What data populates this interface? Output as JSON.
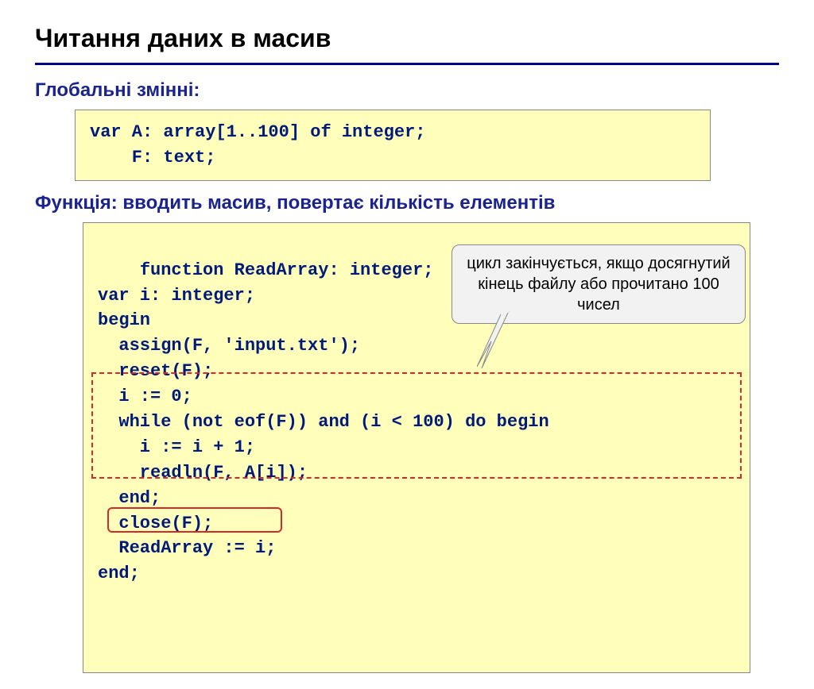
{
  "title": "Читання даних в масив",
  "sub1": "Глобальні змінні:",
  "code1": "var A: array[1..100] of integer;\n    F: text;",
  "sub2": "Функція: вводить масив, повертає кількість елементів",
  "code2": "function ReadArray: integer;\nvar i: integer;\nbegin\n  assign(F, 'input.txt');\n  reset(F);\n  i := 0;\n  while (not eof(F)) and (i < 100) do begin\n    i := i + 1;\n    readln(F, A[i]);\n  end;\n  close(F);\n  ReadArray := i;\nend;",
  "callout": "цикл закінчується, якщо досягнутий кінець файлу або прочитано 100 чисел"
}
